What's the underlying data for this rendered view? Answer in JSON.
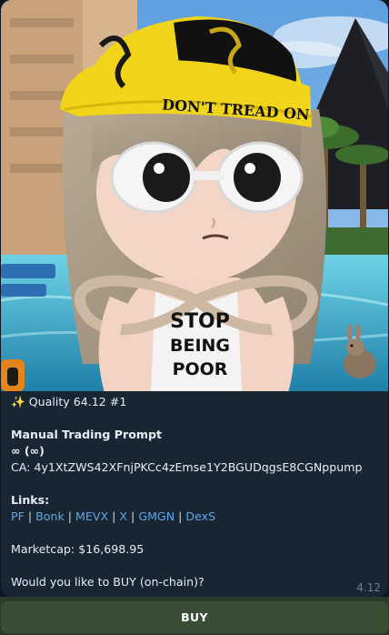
{
  "message": {
    "hat_text": "DON'T TREAD ON",
    "shirt_text": [
      "STOP",
      "BEING",
      "POOR"
    ],
    "quality_emoji": "✨",
    "quality_text": "Quality 64.12 #1",
    "title": "Manual Trading Prompt",
    "symbol_line": "∞ (∞)",
    "ca_label": "CA:",
    "ca_value": "4y1XtZWS42XFnjPKCc4zEmse1Y2BGUDqgsE8CGNppump",
    "links_label": "Links:",
    "links": [
      "PF",
      "Bonk",
      "MEVX",
      "X",
      "GMGN",
      "DexS"
    ],
    "link_separator": "|",
    "marketcap_label": "Marketcap:",
    "marketcap_value": "$16,698.95",
    "question": "Would you like to BUY (on-chain)?",
    "time": "4.12"
  },
  "keyboard": {
    "buy_label": "BUY"
  },
  "colors": {
    "link": "#62a5e5",
    "bubble": "#182533",
    "hat_yellow": "#f2d51a"
  }
}
